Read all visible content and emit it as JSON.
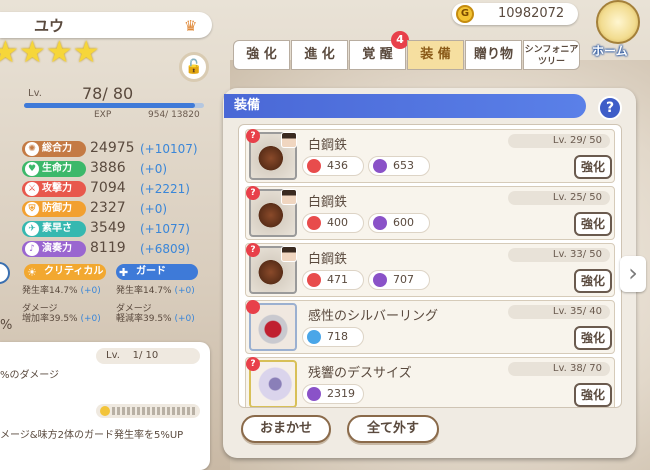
{
  "character": {
    "name": "ユウ",
    "star_count": 4,
    "level_label": "Lv.",
    "level": "78/ 80",
    "level_progress": 0.95,
    "exp_label": "EXP",
    "exp_value": "954/ 13820"
  },
  "stats": [
    {
      "label": "総合力",
      "value": "24975",
      "bonus": "(+10107)",
      "color": "#c47a44",
      "icon": "swirl-icon"
    },
    {
      "label": "生命力",
      "value": "3886",
      "bonus": "(+0)",
      "color": "#3cb86a",
      "icon": "heart-icon"
    },
    {
      "label": "攻撃力",
      "value": "7094",
      "bonus": "(+2221)",
      "color": "#e8584c",
      "icon": "swords-icon"
    },
    {
      "label": "防御力",
      "value": "2327",
      "bonus": "(+0)",
      "color": "#f2a030",
      "icon": "shield-icon"
    },
    {
      "label": "素早さ",
      "value": "3549",
      "bonus": "(+1077)",
      "color": "#36b8b0",
      "icon": "wing-icon"
    },
    {
      "label": "演奏力",
      "value": "8119",
      "bonus": "(+6809)",
      "color": "#9a66d0",
      "icon": "note-icon"
    }
  ],
  "skills": {
    "critical": {
      "label": "クリティカル",
      "color": "#f2a830"
    },
    "guard": {
      "label": "ガード",
      "color": "#3e7ad8"
    },
    "crit_rate_label": "発生率14.7%",
    "crit_rate_bonus": "(+0)",
    "guard_rate_label": "発生率14.7%",
    "guard_rate_bonus": "(+0)",
    "crit_dmg_label1": "ダメージ",
    "crit_dmg_label2": "増加率39.5%",
    "crit_dmg_bonus": "(+0)",
    "guard_dmg_label1": "ダメージ",
    "guard_dmg_label2": "軽減率39.5%",
    "guard_dmg_bonus": "(+0)"
  },
  "left_pct": "%",
  "skill_box": {
    "level_label": "Lv.",
    "level": "1/ 10",
    "line1": "%のダメージ",
    "line2": "メージ&味方2体のガード発生率を5%UP"
  },
  "gold": {
    "icon": "G",
    "value": "10982072"
  },
  "home_label": "ホーム",
  "tabs": [
    {
      "label": "強 化",
      "active": false
    },
    {
      "label": "進 化",
      "active": false
    },
    {
      "label": "覚 醒",
      "active": false,
      "badge": "4"
    },
    {
      "label": "装 備",
      "active": true
    },
    {
      "label": "贈り物",
      "active": false
    },
    {
      "label": "シンフォニア ツリー",
      "active": false,
      "small": true
    }
  ],
  "panel_title": "装備",
  "help": "?",
  "equipment": [
    {
      "name": "白鋼鉄",
      "level": "Lv. 29/ 50",
      "stats": [
        {
          "type": "atk",
          "value": "436"
        },
        {
          "type": "mus",
          "value": "653"
        }
      ],
      "button": "強化",
      "thumb": "shamisen",
      "qmark": "?"
    },
    {
      "name": "白鋼鉄",
      "level": "Lv. 25/ 50",
      "stats": [
        {
          "type": "atk",
          "value": "400"
        },
        {
          "type": "mus",
          "value": "600"
        }
      ],
      "button": "強化",
      "thumb": "shamisen",
      "qmark": "?"
    },
    {
      "name": "白鋼鉄",
      "level": "Lv. 33/ 50",
      "stats": [
        {
          "type": "atk",
          "value": "471"
        },
        {
          "type": "mus",
          "value": "707"
        }
      ],
      "button": "強化",
      "thumb": "shamisen",
      "qmark": "?"
    },
    {
      "name": "感性のシルバーリング",
      "level": "Lv. 35/ 40",
      "stats": [
        {
          "type": "blu",
          "value": "718"
        }
      ],
      "button": "強化",
      "thumb": "ring",
      "qmark": ""
    },
    {
      "name": "残響のデスサイズ",
      "level": "Lv. 38/ 70",
      "stats": [
        {
          "type": "mus",
          "value": "2319"
        }
      ],
      "button": "強化",
      "thumb": "scy",
      "qmark": "?"
    }
  ],
  "buttons": {
    "auto": "おまかせ",
    "remove_all": "全て外す"
  },
  "arrow_right": "›"
}
